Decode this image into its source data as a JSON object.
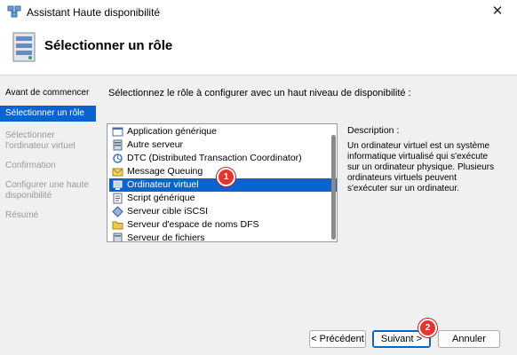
{
  "window": {
    "title": "Assistant Haute disponibilité",
    "close_icon": "close-icon"
  },
  "header": {
    "title": "Sélectionner un rôle"
  },
  "sidebar": {
    "items": [
      {
        "label": "Avant de commencer",
        "state": "enabled"
      },
      {
        "label": "Sélectionner un rôle",
        "state": "active"
      },
      {
        "label": "Sélectionner l'ordinateur virtuel",
        "state": "disabled"
      },
      {
        "label": "Confirmation",
        "state": "disabled"
      },
      {
        "label": "Configurer une haute disponibilité",
        "state": "disabled"
      },
      {
        "label": "Résumé",
        "state": "disabled"
      }
    ]
  },
  "main": {
    "instruction": "Sélectionnez le rôle à configurer avec un haut niveau de disponibilité :",
    "roles": [
      {
        "label": "Application générique",
        "icon": "app-window-icon"
      },
      {
        "label": "Autre serveur",
        "icon": "server-icon"
      },
      {
        "label": "DTC (Distributed Transaction Coordinator)",
        "icon": "dtc-icon"
      },
      {
        "label": "Message Queuing",
        "icon": "message-queue-icon"
      },
      {
        "label": "Ordinateur virtuel",
        "icon": "virtual-machine-icon",
        "selected": true
      },
      {
        "label": "Script générique",
        "icon": "script-icon"
      },
      {
        "label": "Serveur cible iSCSI",
        "icon": "iscsi-target-icon"
      },
      {
        "label": "Serveur d'espace de noms DFS",
        "icon": "dfs-namespace-icon"
      },
      {
        "label": "Serveur de fichiers",
        "icon": "file-server-icon"
      }
    ],
    "description_label": "Description :",
    "description_text": "Un ordinateur virtuel est un système informatique virtualisé qui s'exécute sur un ordinateur physique. Plusieurs ordinateurs virtuels peuvent s'exécuter sur un ordinateur."
  },
  "buttons": {
    "previous": "< Précédent",
    "next": "Suivant >",
    "cancel": "Annuler"
  },
  "annotations": {
    "badge_1": "1",
    "badge_2": "2"
  },
  "colors": {
    "accent": "#0a64d0",
    "badge": "#e3342f"
  }
}
